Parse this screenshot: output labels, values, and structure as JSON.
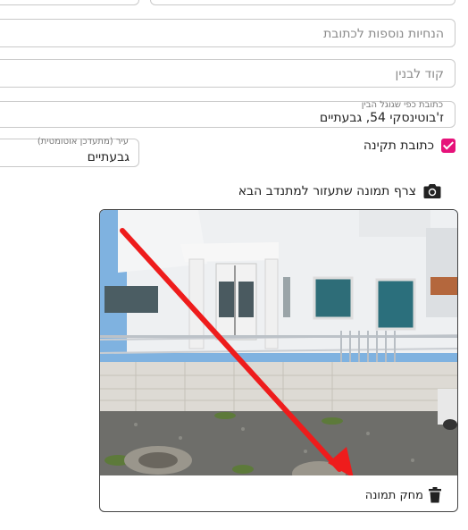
{
  "fields": {
    "extra_instructions": {
      "placeholder": "הנחיות נוספות לכתובת"
    },
    "building_code": {
      "placeholder": "קוד לבנין"
    },
    "google_address": {
      "label": "כתובת כפי שגוגל הבין",
      "value": "ז'בוטינסקי 54, גבעתיים"
    },
    "city": {
      "label": "עיר (מתעדכן אוטומטית)",
      "value": "גבעתיים"
    }
  },
  "valid_address": {
    "label": "כתובת תקינה",
    "checked": true,
    "color": "#e6127a"
  },
  "photo": {
    "attach_label": "צרף תמונה שתעזור למתנדב הבא",
    "delete_label": "מחק תמונה",
    "icons": {
      "camera": "camera-icon",
      "trash": "trash-icon"
    }
  }
}
